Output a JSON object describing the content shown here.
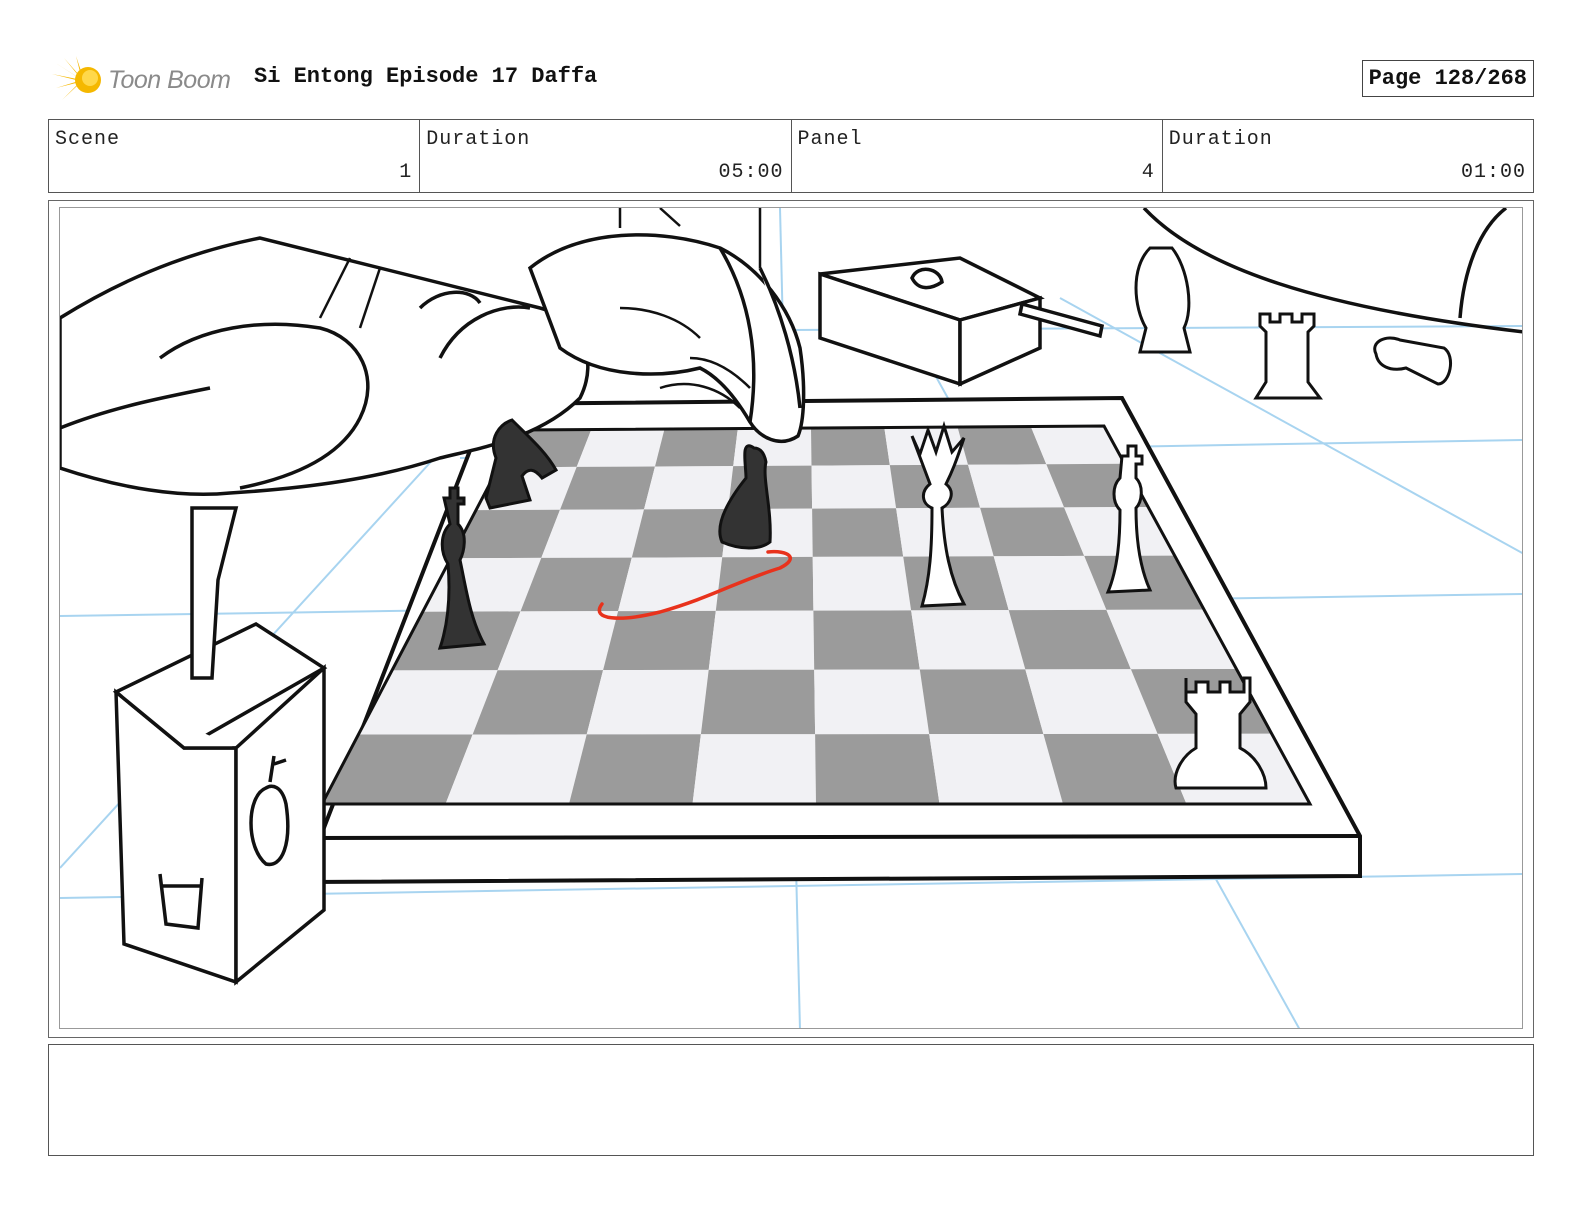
{
  "header": {
    "logo_text": "Toon Boom",
    "project_title": "Si Entong Episode 17 Daffa",
    "page_label": "Page 128/268"
  },
  "info": {
    "scene_label": "Scene",
    "scene_value": "1",
    "scene_duration_label": "Duration",
    "scene_duration_value": "05:00",
    "panel_label": "Panel",
    "panel_value": "4",
    "panel_duration_label": "Duration",
    "panel_duration_value": "01:00"
  },
  "notes": {
    "text": ""
  },
  "colors": {
    "logo_star": "#f5b800",
    "guide_lines": "#a8d4f0",
    "dark_square": "#9b9b9b",
    "motion_arrow": "#e8321c"
  }
}
